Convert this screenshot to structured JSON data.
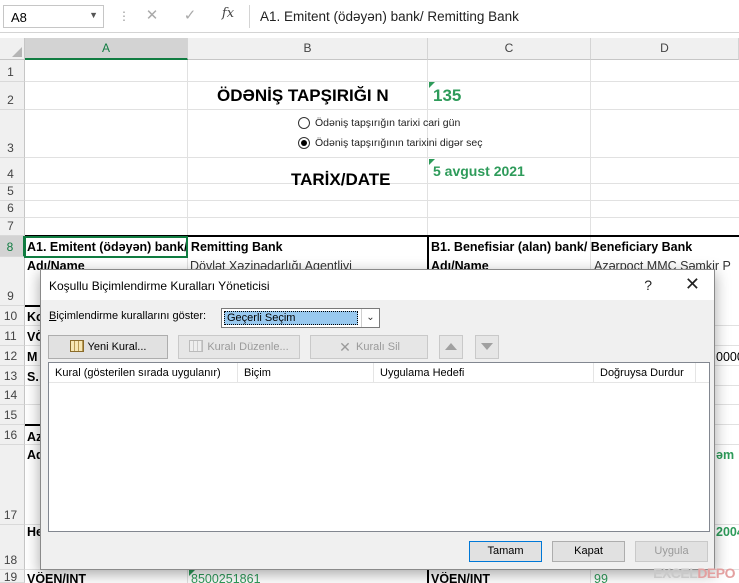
{
  "formula_bar": {
    "name_box": "A8",
    "cancel_icon": "✕",
    "enter_icon": "✓",
    "fx_icon": "fx",
    "content": "A1. Emitent (ödəyən) bank/ Remitting Bank"
  },
  "columns": [
    "A",
    "B",
    "C",
    "D"
  ],
  "rows": [
    "1",
    "2",
    "3",
    "4",
    "5",
    "6",
    "7",
    "8",
    "9",
    "10",
    "11",
    "12",
    "13",
    "14",
    "15",
    "16",
    "17",
    "18",
    "19"
  ],
  "sheet": {
    "title": "ÖDƏNİŞ TAPŞIRIĞI N",
    "number": "135",
    "radio_current": "Ödəniş tapşırığın tarixi cari gün",
    "radio_other": "Ödəniş tapşırığının tarixini digər seç",
    "date_label": "TARİX/DATE",
    "date_value": "5 avgust 2021",
    "a8": "A1. Emitent (ödəyən) bank/ Remitting Bank",
    "c8": "B1. Benefisiar (alan) bank/ Beneficiary Bank",
    "a9": "Adı/Name",
    "b9": "Dövlət Xəzinədarlığı Agentliyi",
    "c9": "Adı/Name",
    "d9": "Azərpoçt MMC Şəmkir P",
    "a10": "Ko",
    "a11": "VÖ",
    "a12": "M",
    "d12": "0000",
    "a13": "S.",
    "a16": "Az",
    "a16b": "Ad",
    "d16": "əm",
    "a18": "He",
    "d18": "2004",
    "a19": "VÖEN/INT",
    "b19": "8500251861",
    "c19": "VÖEN/INT",
    "d19": "99"
  },
  "dialog": {
    "title": "Koşullu Biçimlendirme Kuralları Yöneticisi",
    "help": "?",
    "close": "✕",
    "show_label_prefix": "B",
    "show_label_rest": "içimlendirme kurallarını göster:",
    "show_value": "Geçerli Seçim",
    "buttons": {
      "new_rule": "Yeni Kural...",
      "edit_rule": "Kuralı Düzenle...",
      "delete_rule": "Kuralı Sil"
    },
    "columns": {
      "rule": "Kural (gösterilen sırada uygulanır)",
      "format": "Biçim",
      "applies_to": "Uygulama Hedefi",
      "stop_if_true": "Doğruysa Durdur"
    },
    "footer": {
      "ok": "Tamam",
      "close": "Kapat",
      "apply": "Uygula"
    }
  },
  "watermark": {
    "left": "EXCEL",
    "right": "DEPO"
  },
  "colors": {
    "excel_green": "#107c41",
    "value_green": "#2e9b5a",
    "selection_blue": "#99c9ef"
  }
}
